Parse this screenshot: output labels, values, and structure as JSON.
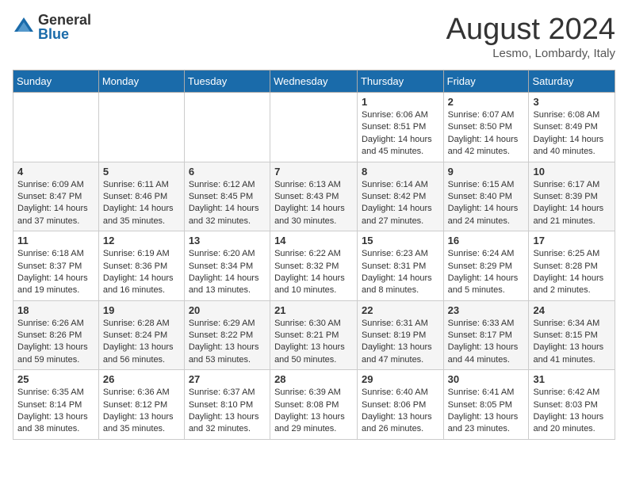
{
  "header": {
    "logo_general": "General",
    "logo_blue": "Blue",
    "month_title": "August 2024",
    "location": "Lesmo, Lombardy, Italy"
  },
  "weekdays": [
    "Sunday",
    "Monday",
    "Tuesday",
    "Wednesday",
    "Thursday",
    "Friday",
    "Saturday"
  ],
  "weeks": [
    [
      {
        "day": "",
        "info": ""
      },
      {
        "day": "",
        "info": ""
      },
      {
        "day": "",
        "info": ""
      },
      {
        "day": "",
        "info": ""
      },
      {
        "day": "1",
        "info": "Sunrise: 6:06 AM\nSunset: 8:51 PM\nDaylight: 14 hours\nand 45 minutes."
      },
      {
        "day": "2",
        "info": "Sunrise: 6:07 AM\nSunset: 8:50 PM\nDaylight: 14 hours\nand 42 minutes."
      },
      {
        "day": "3",
        "info": "Sunrise: 6:08 AM\nSunset: 8:49 PM\nDaylight: 14 hours\nand 40 minutes."
      }
    ],
    [
      {
        "day": "4",
        "info": "Sunrise: 6:09 AM\nSunset: 8:47 PM\nDaylight: 14 hours\nand 37 minutes."
      },
      {
        "day": "5",
        "info": "Sunrise: 6:11 AM\nSunset: 8:46 PM\nDaylight: 14 hours\nand 35 minutes."
      },
      {
        "day": "6",
        "info": "Sunrise: 6:12 AM\nSunset: 8:45 PM\nDaylight: 14 hours\nand 32 minutes."
      },
      {
        "day": "7",
        "info": "Sunrise: 6:13 AM\nSunset: 8:43 PM\nDaylight: 14 hours\nand 30 minutes."
      },
      {
        "day": "8",
        "info": "Sunrise: 6:14 AM\nSunset: 8:42 PM\nDaylight: 14 hours\nand 27 minutes."
      },
      {
        "day": "9",
        "info": "Sunrise: 6:15 AM\nSunset: 8:40 PM\nDaylight: 14 hours\nand 24 minutes."
      },
      {
        "day": "10",
        "info": "Sunrise: 6:17 AM\nSunset: 8:39 PM\nDaylight: 14 hours\nand 21 minutes."
      }
    ],
    [
      {
        "day": "11",
        "info": "Sunrise: 6:18 AM\nSunset: 8:37 PM\nDaylight: 14 hours\nand 19 minutes."
      },
      {
        "day": "12",
        "info": "Sunrise: 6:19 AM\nSunset: 8:36 PM\nDaylight: 14 hours\nand 16 minutes."
      },
      {
        "day": "13",
        "info": "Sunrise: 6:20 AM\nSunset: 8:34 PM\nDaylight: 14 hours\nand 13 minutes."
      },
      {
        "day": "14",
        "info": "Sunrise: 6:22 AM\nSunset: 8:32 PM\nDaylight: 14 hours\nand 10 minutes."
      },
      {
        "day": "15",
        "info": "Sunrise: 6:23 AM\nSunset: 8:31 PM\nDaylight: 14 hours\nand 8 minutes."
      },
      {
        "day": "16",
        "info": "Sunrise: 6:24 AM\nSunset: 8:29 PM\nDaylight: 14 hours\nand 5 minutes."
      },
      {
        "day": "17",
        "info": "Sunrise: 6:25 AM\nSunset: 8:28 PM\nDaylight: 14 hours\nand 2 minutes."
      }
    ],
    [
      {
        "day": "18",
        "info": "Sunrise: 6:26 AM\nSunset: 8:26 PM\nDaylight: 13 hours\nand 59 minutes."
      },
      {
        "day": "19",
        "info": "Sunrise: 6:28 AM\nSunset: 8:24 PM\nDaylight: 13 hours\nand 56 minutes."
      },
      {
        "day": "20",
        "info": "Sunrise: 6:29 AM\nSunset: 8:22 PM\nDaylight: 13 hours\nand 53 minutes."
      },
      {
        "day": "21",
        "info": "Sunrise: 6:30 AM\nSunset: 8:21 PM\nDaylight: 13 hours\nand 50 minutes."
      },
      {
        "day": "22",
        "info": "Sunrise: 6:31 AM\nSunset: 8:19 PM\nDaylight: 13 hours\nand 47 minutes."
      },
      {
        "day": "23",
        "info": "Sunrise: 6:33 AM\nSunset: 8:17 PM\nDaylight: 13 hours\nand 44 minutes."
      },
      {
        "day": "24",
        "info": "Sunrise: 6:34 AM\nSunset: 8:15 PM\nDaylight: 13 hours\nand 41 minutes."
      }
    ],
    [
      {
        "day": "25",
        "info": "Sunrise: 6:35 AM\nSunset: 8:14 PM\nDaylight: 13 hours\nand 38 minutes."
      },
      {
        "day": "26",
        "info": "Sunrise: 6:36 AM\nSunset: 8:12 PM\nDaylight: 13 hours\nand 35 minutes."
      },
      {
        "day": "27",
        "info": "Sunrise: 6:37 AM\nSunset: 8:10 PM\nDaylight: 13 hours\nand 32 minutes."
      },
      {
        "day": "28",
        "info": "Sunrise: 6:39 AM\nSunset: 8:08 PM\nDaylight: 13 hours\nand 29 minutes."
      },
      {
        "day": "29",
        "info": "Sunrise: 6:40 AM\nSunset: 8:06 PM\nDaylight: 13 hours\nand 26 minutes."
      },
      {
        "day": "30",
        "info": "Sunrise: 6:41 AM\nSunset: 8:05 PM\nDaylight: 13 hours\nand 23 minutes."
      },
      {
        "day": "31",
        "info": "Sunrise: 6:42 AM\nSunset: 8:03 PM\nDaylight: 13 hours\nand 20 minutes."
      }
    ]
  ]
}
